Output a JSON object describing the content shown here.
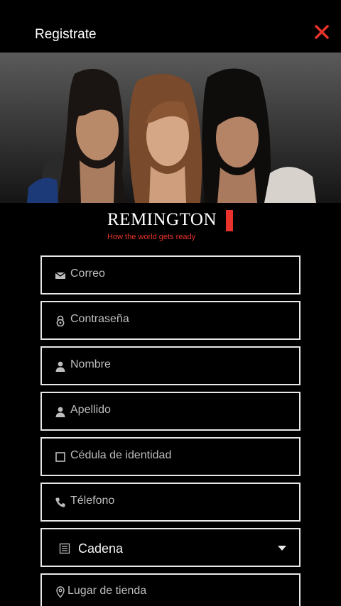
{
  "header": {
    "title": "Registrate",
    "close_icon": "close-icon"
  },
  "brand": {
    "name": "REMINGTON",
    "tagline": "How the world gets ready",
    "accent_color": "#e9322b"
  },
  "form": {
    "email": {
      "placeholder": "Correo",
      "icon": "envelope-icon"
    },
    "password": {
      "placeholder": "Contraseña",
      "icon": "lock-icon"
    },
    "first_name": {
      "placeholder": "Nombre",
      "icon": "user-icon"
    },
    "last_name": {
      "placeholder": "Apellido",
      "icon": "user-icon"
    },
    "id_card": {
      "placeholder": "Cédula de identidad",
      "icon": "checkbox-icon"
    },
    "phone": {
      "placeholder": "Télefono",
      "icon": "phone-icon"
    },
    "chain": {
      "value": "Cadena",
      "icon": "list-icon"
    },
    "store": {
      "placeholder": "Lugar de tienda",
      "icon": "location-pin-icon"
    }
  }
}
